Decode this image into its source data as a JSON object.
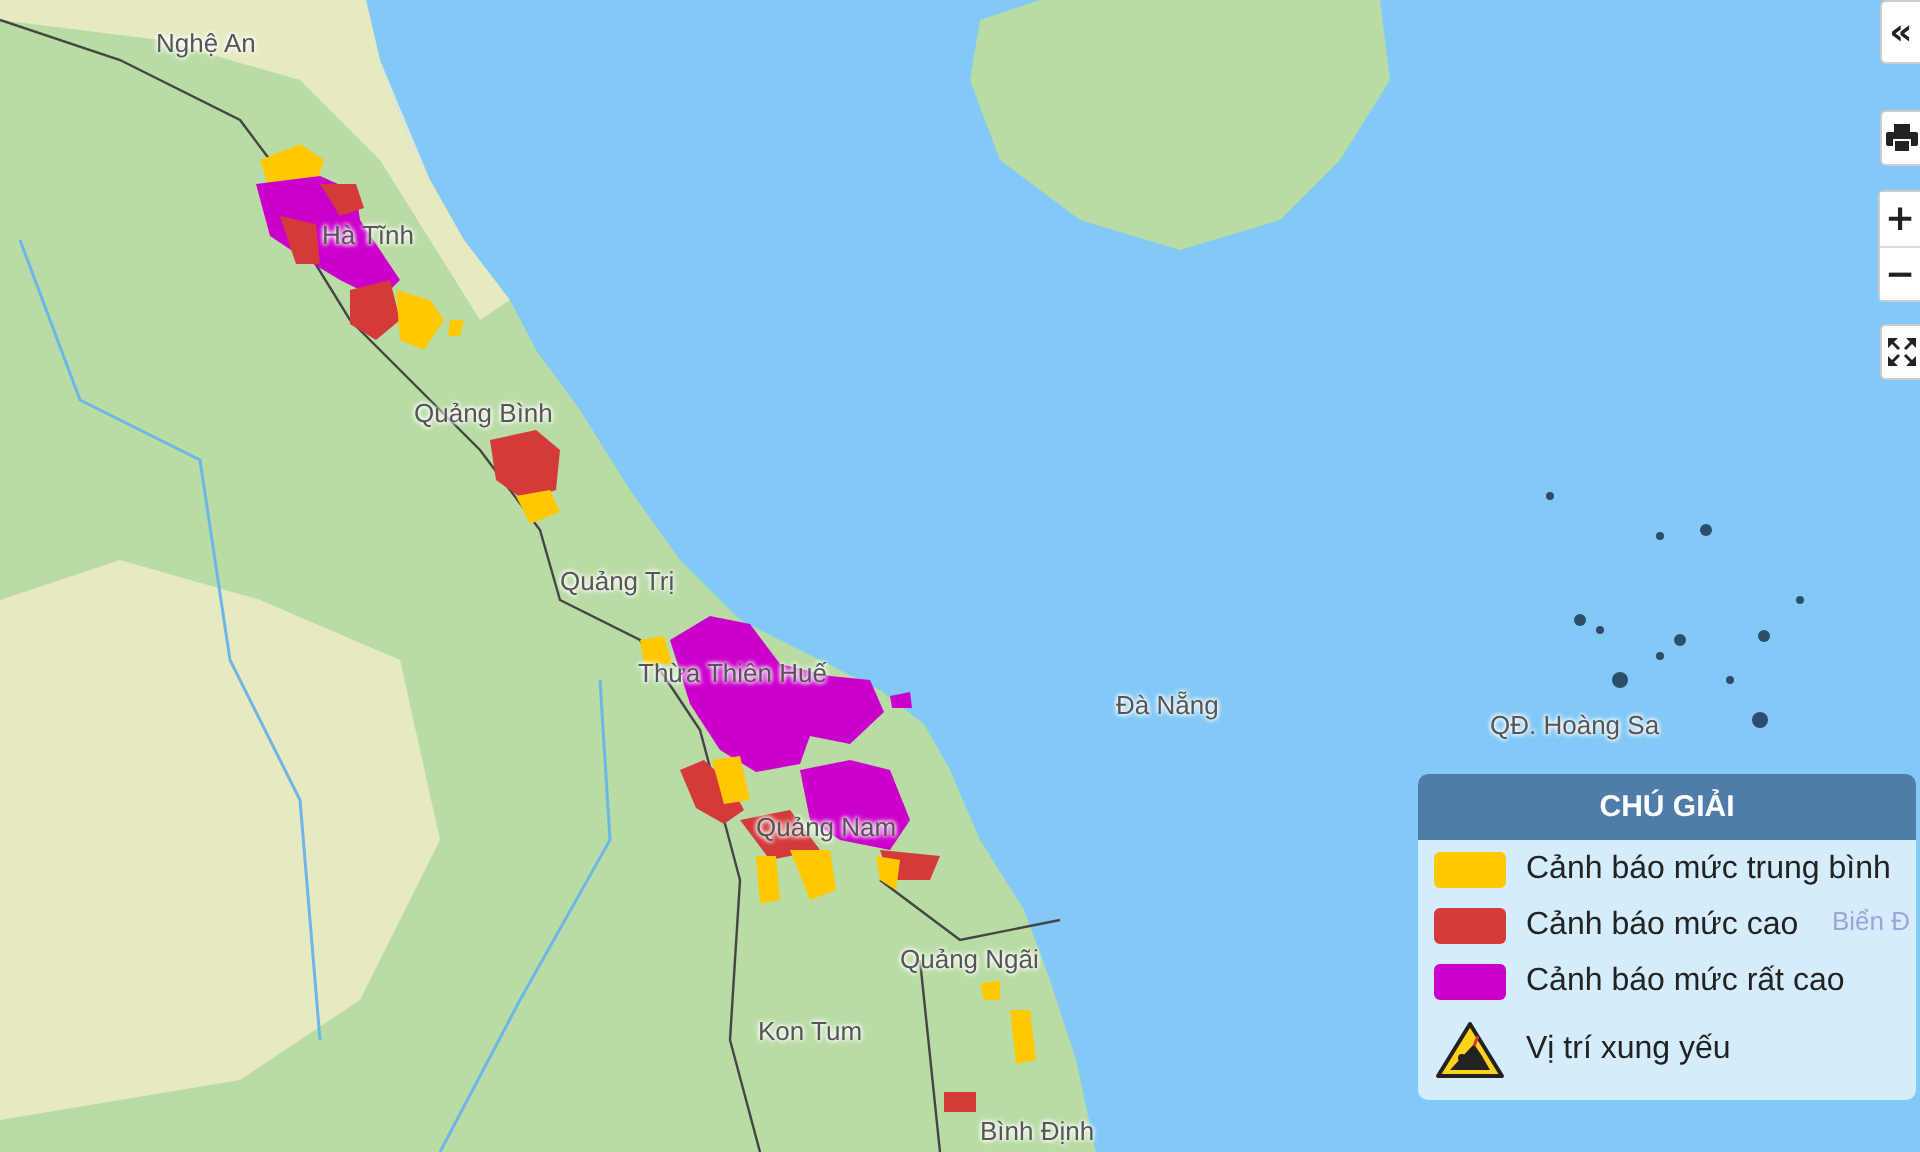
{
  "map": {
    "places": [
      {
        "name": "Nghệ An"
      },
      {
        "name": "Hà Tĩnh"
      },
      {
        "name": "Quảng Bình"
      },
      {
        "name": "Quảng Trị"
      },
      {
        "name": "Thừa Thiên Huế"
      },
      {
        "name": "Đà Nẵng"
      },
      {
        "name": "QĐ. Hoàng Sa"
      },
      {
        "name": "Quảng Nam"
      },
      {
        "name": "Quảng Ngãi"
      },
      {
        "name": "Kon Tum"
      },
      {
        "name": "Bình Định"
      },
      {
        "name": "Biển Đ"
      }
    ]
  },
  "controls": {
    "collapse": "«",
    "zoom_in": "+",
    "zoom_out": "−"
  },
  "legend": {
    "title": "CHÚ GIẢI",
    "items": [
      {
        "kind": "swatch",
        "label": "Cảnh báo mức trung bình",
        "color": "#ffc800"
      },
      {
        "kind": "swatch",
        "label": "Cảnh báo mức cao",
        "color": "#d43a3a"
      },
      {
        "kind": "swatch",
        "label": "Cảnh báo mức rất cao",
        "color": "#cc00cc"
      },
      {
        "kind": "hazard",
        "label": "Vị trí xung yếu"
      }
    ]
  }
}
